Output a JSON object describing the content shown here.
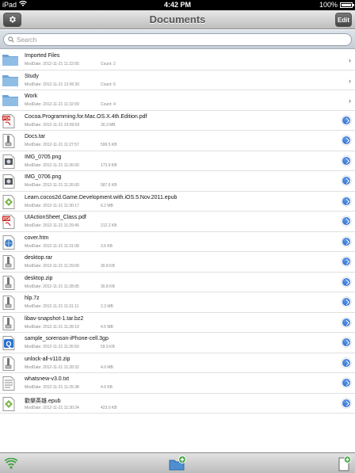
{
  "status_bar": {
    "device": "iPad",
    "time": "4:42 PM",
    "battery": "100%",
    "battery_level": 1.0
  },
  "nav": {
    "title": "Documents",
    "edit_label": "Edit"
  },
  "search": {
    "placeholder": "Search"
  },
  "files": [
    {
      "name": "Imported Files",
      "date": "ModDate: 2012-11-21 11:22:05",
      "size": "Count: 2",
      "type": "folder",
      "accessory": "chevron"
    },
    {
      "name": "Study",
      "date": "ModDate: 2012-11-21 12:06:30",
      "size": "Count: 5",
      "type": "folder",
      "accessory": "chevron"
    },
    {
      "name": "Work",
      "date": "ModDate: 2012-11-21 11:32:09",
      "size": "Count: 4",
      "type": "folder",
      "accessory": "chevron"
    },
    {
      "name": "Cocoa.Programming.for.Mac.OS.X.4th.Edition.pdf",
      "date": "ModDate: 2012-11-21 10:09:59",
      "size": "30.3 MB",
      "type": "pdf",
      "accessory": "disclosure"
    },
    {
      "name": "Docs.tar",
      "date": "ModDate: 2012-11-21 11:27:57",
      "size": "599.5 KB",
      "type": "archive",
      "accessory": "disclosure"
    },
    {
      "name": "IMG_0705.png",
      "date": "ModDate: 2012-11-21 11:26:00",
      "size": "173.9 KB",
      "type": "image",
      "accessory": "disclosure"
    },
    {
      "name": "IMG_0706.png",
      "date": "ModDate: 2012-11-21 11:26:00",
      "size": "587.6 KB",
      "type": "image",
      "accessory": "disclosure"
    },
    {
      "name": "Learn.cocos2d.Game.Development.with.iOS.5.Nov.2011.epub",
      "date": "ModDate: 2012-11-21 11:30:17",
      "size": "6.2 MB",
      "type": "epub",
      "accessory": "disclosure"
    },
    {
      "name": "UIActionSheet_Class.pdf",
      "date": "ModDate: 2012-11-21 11:29:45",
      "size": "212.2 KB",
      "type": "pdf",
      "accessory": "disclosure"
    },
    {
      "name": "cover.htm",
      "date": "ModDate: 2012-11-21 11:31:08",
      "size": "3.6 KB",
      "type": "html",
      "accessory": "disclosure"
    },
    {
      "name": "desktop.rar",
      "date": "ModDate: 2012-11-21 11:29:09",
      "size": "30.8 KB",
      "type": "archive",
      "accessory": "disclosure"
    },
    {
      "name": "desktop.zip",
      "date": "ModDate: 2012-11-21 11:28:05",
      "size": "30.8 KB",
      "type": "archive",
      "accessory": "disclosure"
    },
    {
      "name": "hlp.7z",
      "date": "ModDate: 2012-11-21 11:31:11",
      "size": "2.3 MB",
      "type": "archive",
      "accessory": "disclosure"
    },
    {
      "name": "libav-snapshot-1.tar.bz2",
      "date": "ModDate: 2012-11-21 11:28:19",
      "size": "4.5 MB",
      "type": "archive",
      "accessory": "disclosure"
    },
    {
      "name": "sample_sorenson-iPhone-cell.3gp",
      "date": "ModDate: 2012-11-21 11:26:50",
      "size": "59.9 KB",
      "type": "video",
      "accessory": "disclosure"
    },
    {
      "name": "unlock-all-v110.zip",
      "date": "ModDate: 2012-11-21 11:28:32",
      "size": "4.0 MB",
      "type": "archive",
      "accessory": "disclosure"
    },
    {
      "name": "whatsnew-v3.0.txt",
      "date": "ModDate: 2012-11-21 11:25:38",
      "size": "4.0 KB",
      "type": "text",
      "accessory": "disclosure"
    },
    {
      "name": "歡樂英雄.epub",
      "date": "ModDate: 2012-11-21 11:30:24",
      "size": "423.0 KB",
      "type": "epub",
      "accessory": "disclosure"
    }
  ],
  "colors": {
    "accent": "#1f5fc8",
    "folder": "#6ea3d3",
    "pdf": "#c8201a",
    "epub": "#7ab648"
  },
  "icons": {
    "settings": "gear-icon",
    "wifi": "wifi-icon",
    "new_folder": "new-folder-icon",
    "new_file": "new-file-icon"
  }
}
